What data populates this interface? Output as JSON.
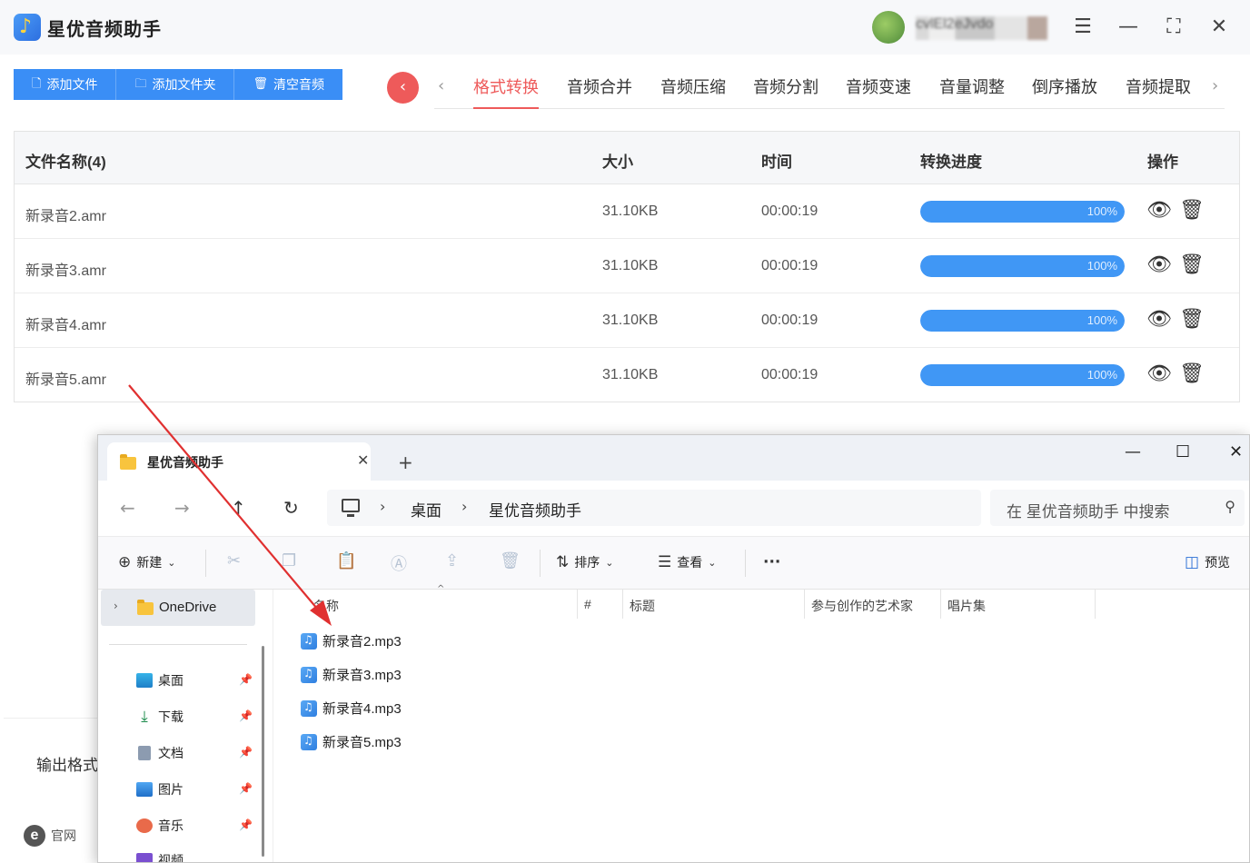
{
  "app": {
    "title": "星优音频助手",
    "user_name": "cvlEl2eJvdo"
  },
  "toolbar": {
    "add_file": "添加文件",
    "add_folder": "添加文件夹",
    "clear": "清空音频"
  },
  "tabs": [
    "格式转换",
    "音频合并",
    "音频压缩",
    "音频分割",
    "音频变速",
    "音量调整",
    "倒序播放",
    "音频提取"
  ],
  "active_tab": "格式转换",
  "table": {
    "headers": {
      "name": "文件名称(4)",
      "size": "大小",
      "time": "时间",
      "progress": "转换进度",
      "ops": "操作"
    },
    "rows": [
      {
        "name": "新录音2.amr",
        "size": "31.10KB",
        "time": "00:00:19",
        "progress": 100,
        "progress_label": "100%"
      },
      {
        "name": "新录音3.amr",
        "size": "31.10KB",
        "time": "00:00:19",
        "progress": 100,
        "progress_label": "100%"
      },
      {
        "name": "新录音4.amr",
        "size": "31.10KB",
        "time": "00:00:19",
        "progress": 100,
        "progress_label": "100%"
      },
      {
        "name": "新录音5.amr",
        "size": "31.10KB",
        "time": "00:00:19",
        "progress": 100,
        "progress_label": "100%"
      }
    ]
  },
  "bottom": {
    "output_format_label": "输出格式",
    "site_label": "官网"
  },
  "explorer": {
    "tab_title": "星优音频助手",
    "breadcrumb": [
      "桌面",
      "星优音频助手"
    ],
    "search_placeholder": "在 星优音频助手 中搜索",
    "commands": {
      "new": "新建",
      "sort": "排序",
      "view": "查看",
      "preview": "预览"
    },
    "sidebar": {
      "onedrive": "OneDrive",
      "items": [
        "桌面",
        "下载",
        "文档",
        "图片",
        "音乐",
        "视频"
      ]
    },
    "columns": [
      "名称",
      "#",
      "标题",
      "参与创作的艺术家",
      "唱片集"
    ],
    "files": [
      "新录音2.mp3",
      "新录音3.mp3",
      "新录音4.mp3",
      "新录音5.mp3"
    ]
  },
  "colors": {
    "accent_blue": "#3a8ef6",
    "accent_red": "#ee5a5a",
    "progress_blue": "#4097f5"
  }
}
